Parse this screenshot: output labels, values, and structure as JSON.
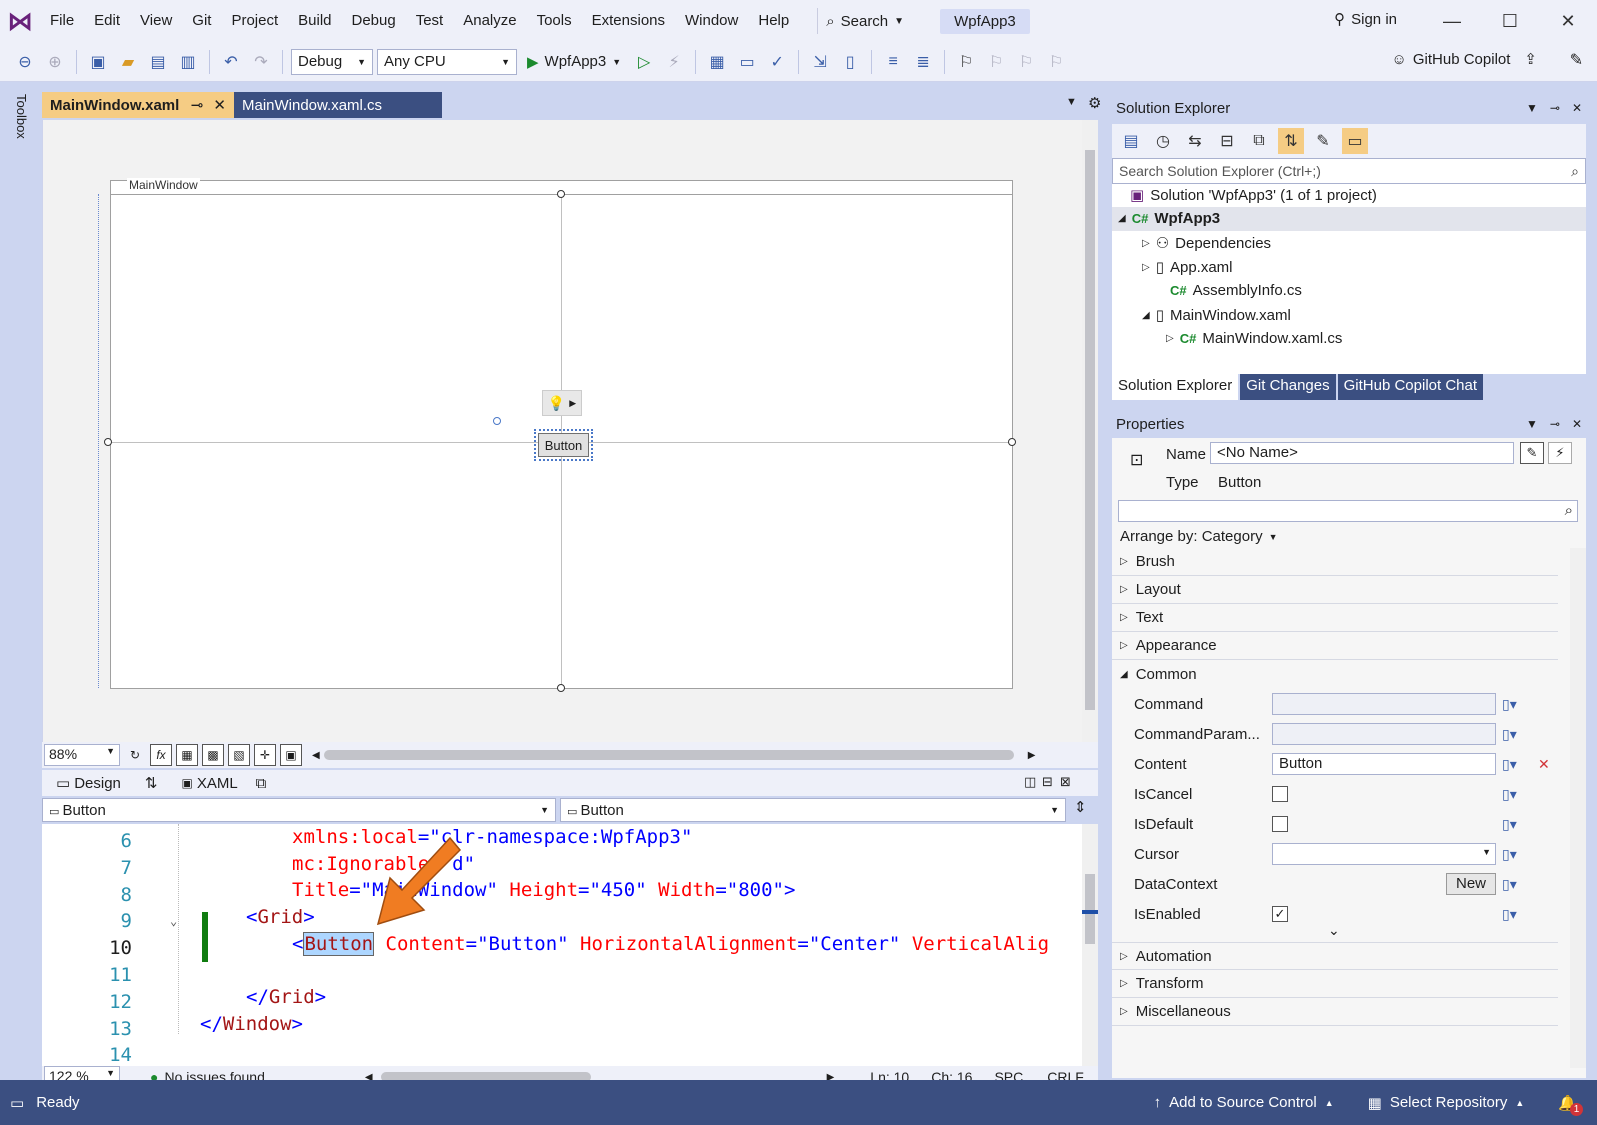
{
  "menu": {
    "items": [
      "File",
      "Edit",
      "View",
      "Git",
      "Project",
      "Build",
      "Debug",
      "Test",
      "Analyze",
      "Tools",
      "Extensions",
      "Window",
      "Help"
    ],
    "search_label": "Search",
    "solution_name": "WpfApp3",
    "sign_in": "Sign in"
  },
  "toolbar": {
    "configuration": "Debug",
    "platform": "Any CPU",
    "run_target": "WpfApp3",
    "copilot_label": "GitHub Copilot"
  },
  "toolbox_label": "Toolbox",
  "tabs": {
    "active": "MainWindow.xaml",
    "inactive": "MainWindow.xaml.cs"
  },
  "designer": {
    "window_title": "MainWindow",
    "button_text": "Button",
    "zoom": "88%",
    "fx_label": "fx"
  },
  "split": {
    "design_label": "Design",
    "xaml_label": "XAML"
  },
  "xaml_combos": {
    "left": "Button",
    "right": "Button"
  },
  "editor": {
    "lines": [
      {
        "num": "6",
        "text": "xmlns:local=\"clr-namespace:WpfApp3\""
      },
      {
        "num": "7",
        "text": "mc:Ignorable=\"d\""
      },
      {
        "num": "8",
        "text": "Title=\"MainWindow\" Height=\"450\" Width=\"800\">"
      },
      {
        "num": "9",
        "text": "<Grid>"
      },
      {
        "num": "10",
        "text": "<Button Content=\"Button\" HorizontalAlignment=\"Center\" VerticalAlig"
      },
      {
        "num": "11",
        "text": ""
      },
      {
        "num": "12",
        "text": "</Grid>"
      },
      {
        "num": "13",
        "text": "</Window>"
      },
      {
        "num": "14",
        "text": ""
      }
    ],
    "zoom": "122 %",
    "issues": "No issues found",
    "ln": "Ln: 10",
    "ch": "Ch: 16",
    "spc": "SPC",
    "crlf": "CRLF"
  },
  "solution_explorer": {
    "title": "Solution Explorer",
    "search_placeholder": "Search Solution Explorer (Ctrl+;)",
    "solution": "Solution 'WpfApp3' (1 of 1 project)",
    "project": "WpfApp3",
    "dependencies": "Dependencies",
    "app_xaml": "App.xaml",
    "assembly_info": "AssemblyInfo.cs",
    "main_window": "MainWindow.xaml",
    "main_window_cs": "MainWindow.xaml.cs",
    "tabs": [
      "Solution Explorer",
      "Git Changes",
      "GitHub Copilot Chat"
    ]
  },
  "properties": {
    "title": "Properties",
    "name_label": "Name",
    "name_value": "<No Name>",
    "type_label": "Type",
    "type_value": "Button",
    "arrange_by": "Arrange by: Category",
    "categories_top": [
      "Brush",
      "Layout",
      "Text",
      "Appearance",
      "Common"
    ],
    "common": {
      "command": "Command",
      "command_param": "CommandParam...",
      "content": "Content",
      "content_value": "Button",
      "is_cancel": "IsCancel",
      "is_default": "IsDefault",
      "cursor": "Cursor",
      "data_context": "DataContext",
      "data_context_btn": "New",
      "is_enabled": "IsEnabled"
    },
    "categories_bottom": [
      "Automation",
      "Transform",
      "Miscellaneous"
    ]
  },
  "status": {
    "ready": "Ready",
    "add_source": "Add to Source Control",
    "select_repo": "Select Repository",
    "notif_count": "1"
  }
}
